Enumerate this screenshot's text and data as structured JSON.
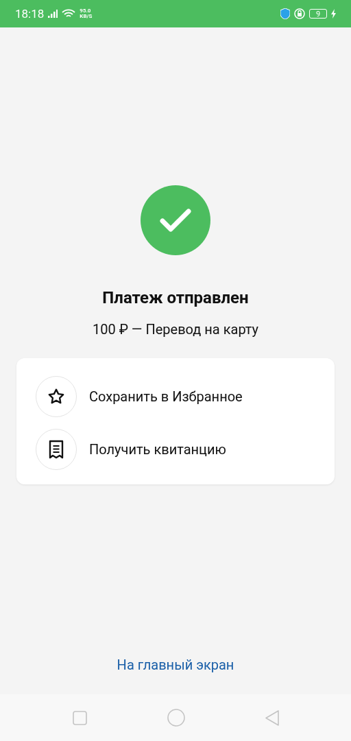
{
  "status_bar": {
    "time": "18:18",
    "speed_value": "95.0",
    "speed_unit": "KB/S",
    "battery": "9"
  },
  "result": {
    "title": "Платеж отправлен",
    "subtitle": "100 ₽ — Перевод на карту"
  },
  "actions": [
    {
      "kind": "star",
      "label": "Сохранить в Избранное"
    },
    {
      "kind": "receipt",
      "label": "Получить квитанцию"
    }
  ],
  "home_link": "На главный экран"
}
